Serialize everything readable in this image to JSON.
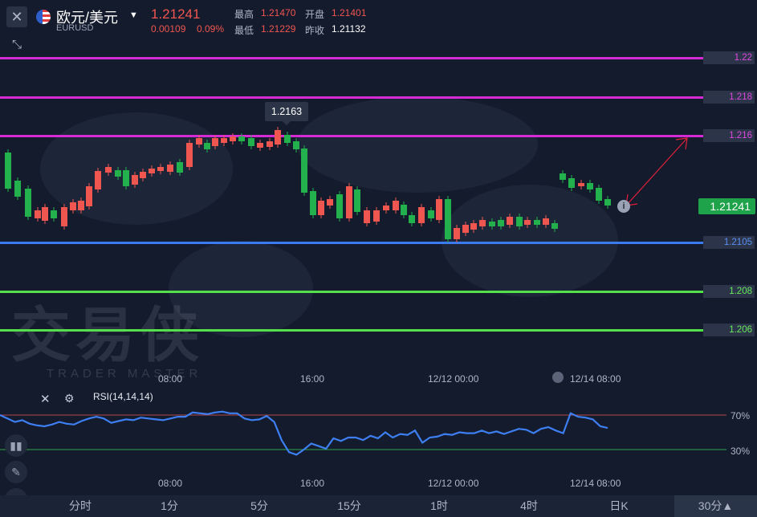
{
  "header": {
    "symbol_name": "欧元/美元",
    "symbol_code": "EURUSD",
    "last_price": "1.21241",
    "change": "0.00109",
    "change_pct": "0.09%",
    "high_label": "最高",
    "high_value": "1.21470",
    "open_label": "开盘",
    "open_value": "1.21401",
    "low_label": "最低",
    "low_value": "1.21229",
    "prev_close_label": "昨收",
    "prev_close_value": "1.21132"
  },
  "levels": {
    "l1": "1.22",
    "l2": "1.218",
    "l3": "1.216",
    "l4": "1.2105",
    "l5": "1.208",
    "l6": "1.206",
    "current": "1.21241"
  },
  "colors": {
    "magenta": "#d42bd4",
    "blue": "#3a7bf0",
    "green": "#54e04a",
    "up": "#f05650",
    "down": "#22b14c",
    "rsi_line": "#3d7ff2"
  },
  "callout": "1.2163",
  "main_x_ticks": [
    "08:00",
    "16:00",
    "12/12 00:00",
    "12/14 08:00"
  ],
  "watermark": {
    "brand": "交易侠",
    "sub": "TRADER MASTER"
  },
  "rsi": {
    "label": "RSI(14,14,14)",
    "upper": "70%",
    "lower": "30%",
    "values": [
      70,
      66,
      62,
      64,
      60,
      58,
      57,
      59,
      62,
      60,
      59,
      63,
      66,
      68,
      66,
      61,
      63,
      65,
      64,
      67,
      66,
      65,
      64,
      66,
      68,
      68,
      73,
      72,
      71,
      73,
      74,
      72,
      72,
      66,
      64,
      65,
      69,
      62,
      41,
      27,
      24,
      30,
      37,
      34,
      31,
      43,
      40,
      44,
      44,
      41,
      46,
      43,
      50,
      44,
      48,
      47,
      52,
      38,
      44,
      45,
      48,
      47,
      50,
      49,
      49,
      52,
      49,
      51,
      48,
      51,
      54,
      53,
      49,
      54,
      56,
      52,
      49,
      72,
      68,
      67,
      65,
      57,
      55
    ]
  },
  "rsi_x_ticks": [
    "08:00",
    "16:00",
    "12/12 00:00",
    "12/14 08:00"
  ],
  "tabs": [
    "分时",
    "1分",
    "5分",
    "15分",
    "1时",
    "4时",
    "日K",
    "30分▲"
  ]
}
